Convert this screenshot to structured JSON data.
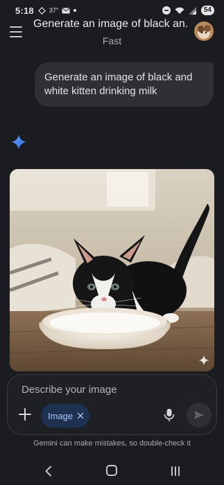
{
  "status_bar": {
    "time": "5:18",
    "temperature": "37°",
    "battery": "54"
  },
  "header": {
    "title": "Generate an image of black an...",
    "subtitle": "Fast",
    "menu_icon": "hamburger-menu-icon",
    "avatar_icon": "user-avatar"
  },
  "conversation": {
    "user_prompt": "Generate an image of black and white kitten drinking milk",
    "assistant_icon": "gemini-sparkle-icon",
    "generated_image": "black and white kitten drinking milk from a bowl"
  },
  "composer": {
    "placeholder": "Describe your image",
    "chip_label": "Image",
    "chip_close_icon": "close-icon",
    "add_icon": "plus-icon",
    "mic_icon": "microphone-icon",
    "send_icon": "send-icon"
  },
  "disclaimer": "Gemini can make mistakes, so double-check it",
  "nav": {
    "back_icon": "back-icon",
    "home_icon": "home-icon",
    "recents_icon": "recents-icon"
  },
  "colors": {
    "background": "#1b1c1f",
    "bubble": "#2e3034",
    "chip_bg": "#1e3150",
    "chip_text": "#a8c7fa",
    "sparkle": "#4b8ef7"
  }
}
